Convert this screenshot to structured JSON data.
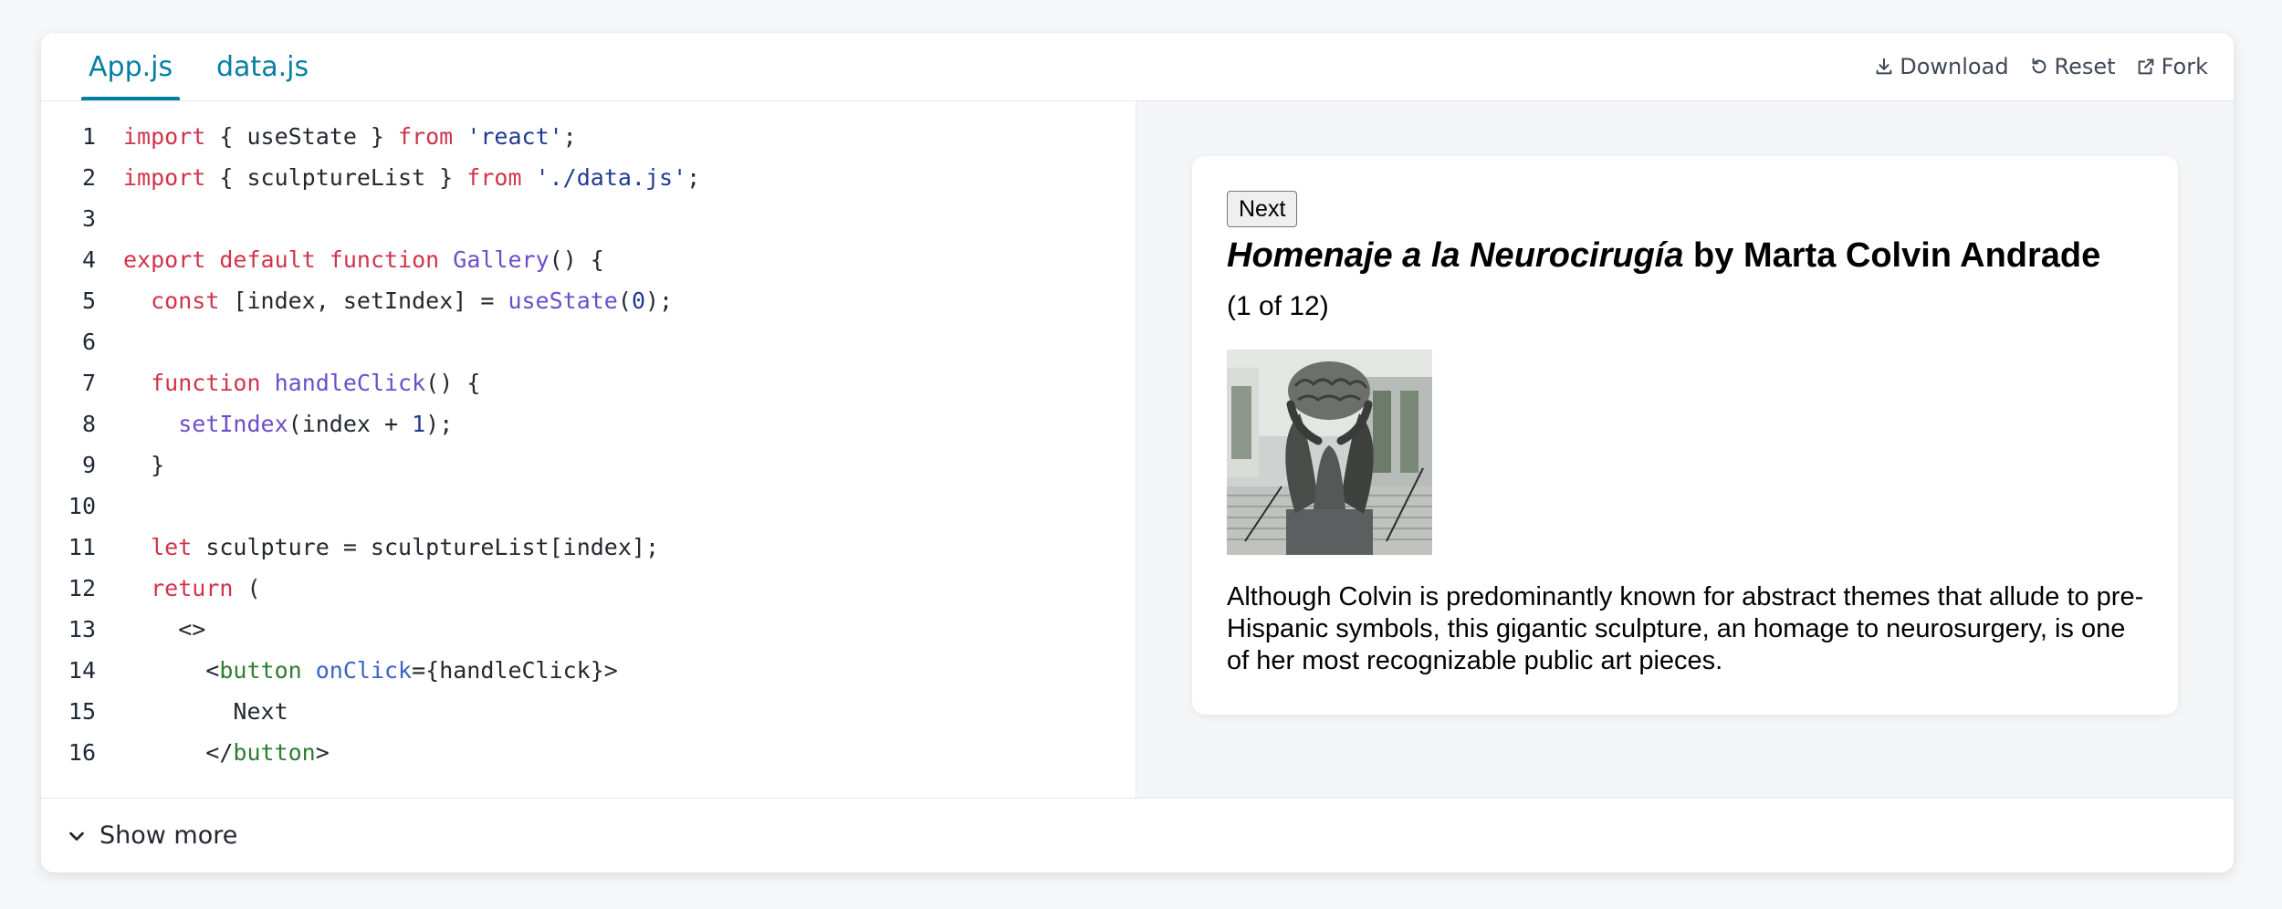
{
  "tabs": [
    {
      "label": "App.js",
      "active": true
    },
    {
      "label": "data.js",
      "active": false
    }
  ],
  "actions": {
    "download": "Download",
    "reset": "Reset",
    "fork": "Fork"
  },
  "code_lines": [
    {
      "n": "1"
    },
    {
      "n": "2"
    },
    {
      "n": "3"
    },
    {
      "n": "4"
    },
    {
      "n": "5"
    },
    {
      "n": "6"
    },
    {
      "n": "7"
    },
    {
      "n": "8"
    },
    {
      "n": "9"
    },
    {
      "n": "10"
    },
    {
      "n": "11"
    },
    {
      "n": "12"
    },
    {
      "n": "13"
    },
    {
      "n": "14"
    },
    {
      "n": "15"
    },
    {
      "n": "16"
    }
  ],
  "code": {
    "l1": [
      "import",
      " { useState } ",
      "from",
      " ",
      "'react'",
      ";"
    ],
    "l2": [
      "import",
      " { sculptureList } ",
      "from",
      " ",
      "'./data.js'",
      ";"
    ],
    "l4": [
      "export",
      " ",
      "default",
      " ",
      "function",
      " ",
      "Gallery",
      "() {"
    ],
    "l5": [
      "  ",
      "const",
      " [index, setIndex] = ",
      "useState",
      "(",
      "0",
      ");"
    ],
    "l7": [
      "  ",
      "function",
      " ",
      "handleClick",
      "() {"
    ],
    "l8": [
      "    ",
      "setIndex",
      "(index + ",
      "1",
      ");"
    ],
    "l9": [
      "  }"
    ],
    "l11": [
      "  ",
      "let",
      " sculpture = sculptureList[index];"
    ],
    "l12": [
      "  ",
      "return",
      " ("
    ],
    "l13": [
      "    <>"
    ],
    "l14": [
      "      <",
      "button",
      " ",
      "onClick",
      "={handleClick}>"
    ],
    "l15": [
      "        Next"
    ],
    "l16": [
      "      </",
      "button",
      ">"
    ]
  },
  "preview": {
    "next_button": "Next",
    "title_italic": "Homenaje a la Neurocirugía",
    "title_rest": " by Marta Colvin Andrade",
    "counter": "(1 of 12)",
    "description": "Although Colvin is predominantly known for abstract themes that allude to pre-Hispanic symbols, this gigantic sculpture, an homage to neurosurgery, is one of her most recognizable public art pieces."
  },
  "footer": {
    "show_more": "Show more"
  },
  "colors": {
    "accent": "#087ea4",
    "keyword": "#d1344b",
    "function": "#6a4ecb",
    "string": "#1f3a93",
    "tag": "#2e7d32"
  }
}
